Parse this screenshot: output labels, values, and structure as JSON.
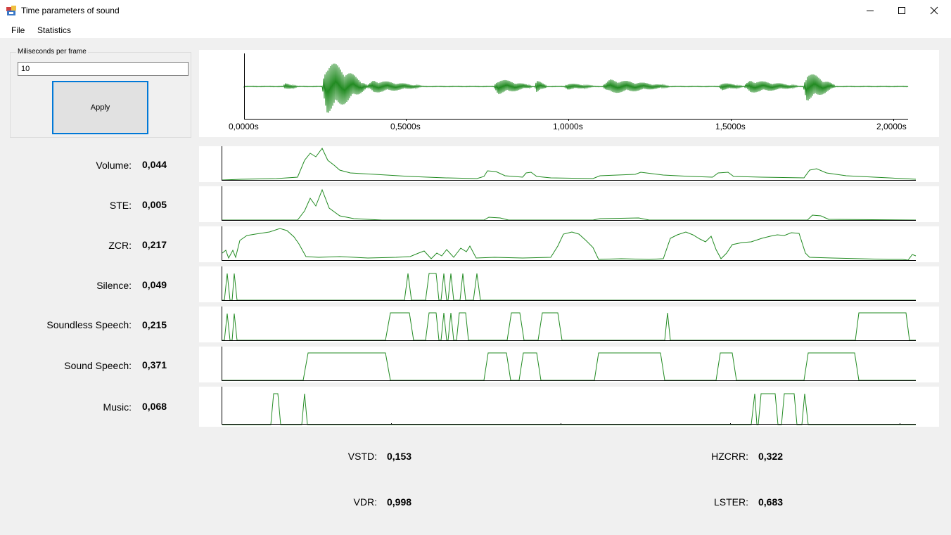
{
  "window": {
    "title": "Time parameters of sound",
    "icons": [
      "app-icon",
      "minimize-icon",
      "maximize-icon",
      "close-icon"
    ]
  },
  "menu": {
    "items": [
      "File",
      "Statistics"
    ]
  },
  "settings": {
    "group_label": "Miliseconds per frame",
    "frame_ms_value": "10",
    "apply_label": "Apply"
  },
  "waveform": {
    "x_ticks": [
      "0,0000s",
      "0,5000s",
      "1,0000s",
      "1,5000s",
      "2,0000s"
    ],
    "line_color": "#228b22"
  },
  "metrics": [
    {
      "label": "Volume:",
      "value": "0,044"
    },
    {
      "label": "STE:",
      "value": "0,005"
    },
    {
      "label": "ZCR:",
      "value": "0,217"
    },
    {
      "label": "Silence:",
      "value": "0,049"
    },
    {
      "label": "Soundless Speech:",
      "value": "0,215"
    },
    {
      "label": "Sound Speech:",
      "value": "0,371"
    },
    {
      "label": "Music:",
      "value": "0,068"
    }
  ],
  "stats": {
    "vstd": {
      "label": "VSTD:",
      "value": "0,153"
    },
    "hzcrr": {
      "label": "HZCRR:",
      "value": "0,322"
    },
    "vdr": {
      "label": "VDR:",
      "value": "0,998"
    },
    "lster": {
      "label": "LSTER:",
      "value": "0,683"
    }
  }
}
